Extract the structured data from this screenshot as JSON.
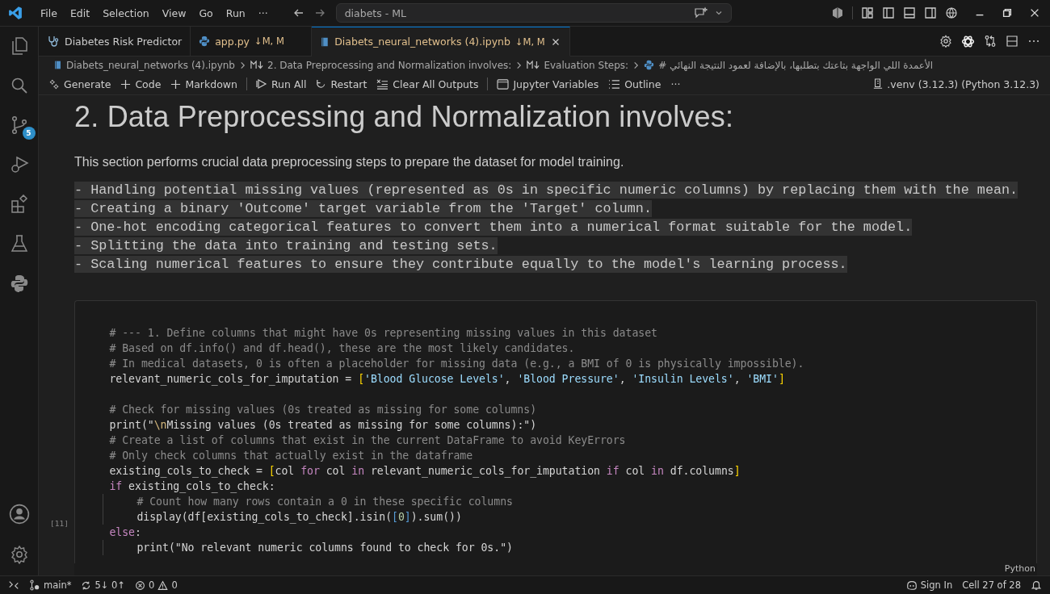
{
  "menu": [
    "File",
    "Edit",
    "Selection",
    "View",
    "Go",
    "Run",
    "···"
  ],
  "command_center": {
    "value": "diabets - ML"
  },
  "tabs": [
    {
      "label": "Diabetes Risk Predictor",
      "kind": "stethoscope",
      "selected": false,
      "closable": false
    },
    {
      "label": "app.py",
      "kind": "python",
      "status": "↓M, M",
      "selected": false,
      "closable": false
    },
    {
      "label": "Diabets_neural_networks (4).ipynb",
      "kind": "notebook",
      "status": "↓M, M",
      "selected": true,
      "closable": true
    }
  ],
  "breadcrumb": [
    {
      "kind": "notebook",
      "text": "Diabets_neural_networks (4).ipynb"
    },
    {
      "kind": "markdown",
      "text": "2. Data Preprocessing and Normalization involves:"
    },
    {
      "kind": "markdown",
      "text": "Evaluation Steps:"
    },
    {
      "kind": "python",
      "text": "# الأعمدة اللي الواجهة بتاعتك بتطلبها، بالإضافة لعمود النتيجة النهائي"
    }
  ],
  "toolbar": [
    {
      "kind": "generate",
      "label": "Generate"
    },
    {
      "kind": "plus",
      "label": "Code"
    },
    {
      "kind": "plus",
      "label": "Markdown"
    },
    {
      "kind": "separator"
    },
    {
      "kind": "run",
      "label": "Run All"
    },
    {
      "kind": "restart",
      "label": "Restart"
    },
    {
      "kind": "clear",
      "label": "Clear All Outputs"
    },
    {
      "kind": "separator"
    },
    {
      "kind": "variables",
      "label": "Jupyter Variables"
    },
    {
      "kind": "outline",
      "label": "Outline"
    },
    {
      "kind": "more",
      "label": "···"
    }
  ],
  "kernel": ".venv (3.12.3) (Python 3.12.3)",
  "source_control_badge": "5",
  "markdown_cell": {
    "heading": "2. Data Preprocessing and Normalization involves:",
    "paragraph": "This section performs crucial data preprocessing steps to prepare the dataset for model training.",
    "code_lines": [
      "- Handling potential missing values (represented as 0s in specific numeric columns) by replacing them with the mean.",
      "- Creating a binary 'Outcome' target variable from the 'Target' column.",
      "- One-hot encoding categorical features to convert them into a numerical format suitable for the model.",
      "- Splitting the data into training and testing sets.",
      "- Scaling numerical features to ensure they contribute equally to the model's learning process."
    ]
  },
  "code_cell": {
    "execution_count": "[11]",
    "language": "Python",
    "lines": [
      {
        "tokens": [
          {
            "kind": "comment",
            "text": "# --- 1. Define columns that might have 0s representing missing values in this dataset"
          }
        ]
      },
      {
        "tokens": [
          {
            "kind": "comment",
            "text": "# Based on df.info() and df.head(), these are the most likely candidates."
          }
        ]
      },
      {
        "tokens": [
          {
            "kind": "comment",
            "text": "# In medical datasets, 0 is often a placeholder for missing data (e.g., a BMI of 0 is physically impossible)."
          }
        ]
      },
      {
        "tokens": [
          {
            "kind": "plain",
            "text": "relevant_numeric_cols_for_imputation = "
          },
          {
            "kind": "bracket",
            "text": "["
          },
          {
            "kind": "string",
            "text": "'Blood Glucose Levels'"
          },
          {
            "kind": "plain",
            "text": ", "
          },
          {
            "kind": "string",
            "text": "'Blood Pressure'"
          },
          {
            "kind": "plain",
            "text": ", "
          },
          {
            "kind": "string",
            "text": "'Insulin Levels'"
          },
          {
            "kind": "plain",
            "text": ", "
          },
          {
            "kind": "string",
            "text": "'BMI'"
          },
          {
            "kind": "bracket",
            "text": "]"
          }
        ]
      },
      {
        "gap_before": true,
        "tokens": [
          {
            "kind": "comment",
            "text": "# Check for missing values (0s treated as missing for some columns)"
          }
        ]
      },
      {
        "tokens": [
          {
            "kind": "plain",
            "text": "print(\""
          },
          {
            "kind": "escape",
            "text": "\\n"
          },
          {
            "kind": "plain",
            "text": "Missing values (0s treated as missing for some columns):\")"
          }
        ]
      },
      {
        "tokens": [
          {
            "kind": "comment",
            "text": "# Create a list of columns that exist in the current DataFrame to avoid KeyErrors"
          }
        ]
      },
      {
        "tokens": [
          {
            "kind": "comment",
            "text": "# Only check columns that actually exist in the dataframe"
          }
        ]
      },
      {
        "tokens": [
          {
            "kind": "plain",
            "text": "existing_cols_to_check = "
          },
          {
            "kind": "bracket",
            "text": "["
          },
          {
            "kind": "plain",
            "text": "col "
          },
          {
            "kind": "keyword",
            "text": "for"
          },
          {
            "kind": "plain",
            "text": " col "
          },
          {
            "kind": "keyword",
            "text": "in"
          },
          {
            "kind": "plain",
            "text": " relevant_numeric_cols_for_imputation "
          },
          {
            "kind": "keyword",
            "text": "if"
          },
          {
            "kind": "plain",
            "text": " col "
          },
          {
            "kind": "keyword",
            "text": "in"
          },
          {
            "kind": "plain",
            "text": " df.columns"
          },
          {
            "kind": "bracket",
            "text": "]"
          }
        ]
      },
      {
        "tokens": [
          {
            "kind": "keyword",
            "text": "if"
          },
          {
            "kind": "plain",
            "text": " existing_cols_to_check:"
          }
        ]
      },
      {
        "indented": true,
        "tokens": [
          {
            "kind": "comment",
            "text": "# Count how many rows contain a 0 in these specific columns"
          }
        ]
      },
      {
        "indented": true,
        "tokens": [
          {
            "kind": "plain",
            "text": "display(df[existing_cols_to_check].isin("
          },
          {
            "kind": "inner",
            "text": "["
          },
          {
            "kind": "number",
            "text": "0"
          },
          {
            "kind": "inner",
            "text": "]"
          },
          {
            "kind": "plain",
            "text": ").sum())"
          }
        ]
      },
      {
        "tokens": [
          {
            "kind": "keyword",
            "text": "else"
          },
          {
            "kind": "plain",
            "text": ":"
          }
        ]
      },
      {
        "indented": true,
        "tokens": [
          {
            "kind": "plain",
            "text": "print(\"No relevant numeric columns found to check for 0s.\")"
          }
        ]
      }
    ]
  },
  "status_bar": {
    "branch": "main*",
    "sync": "5↓ 0↑",
    "errors": "0",
    "warnings": "0",
    "sign_in": "Sign In",
    "cell": "Cell 27 of 28"
  }
}
